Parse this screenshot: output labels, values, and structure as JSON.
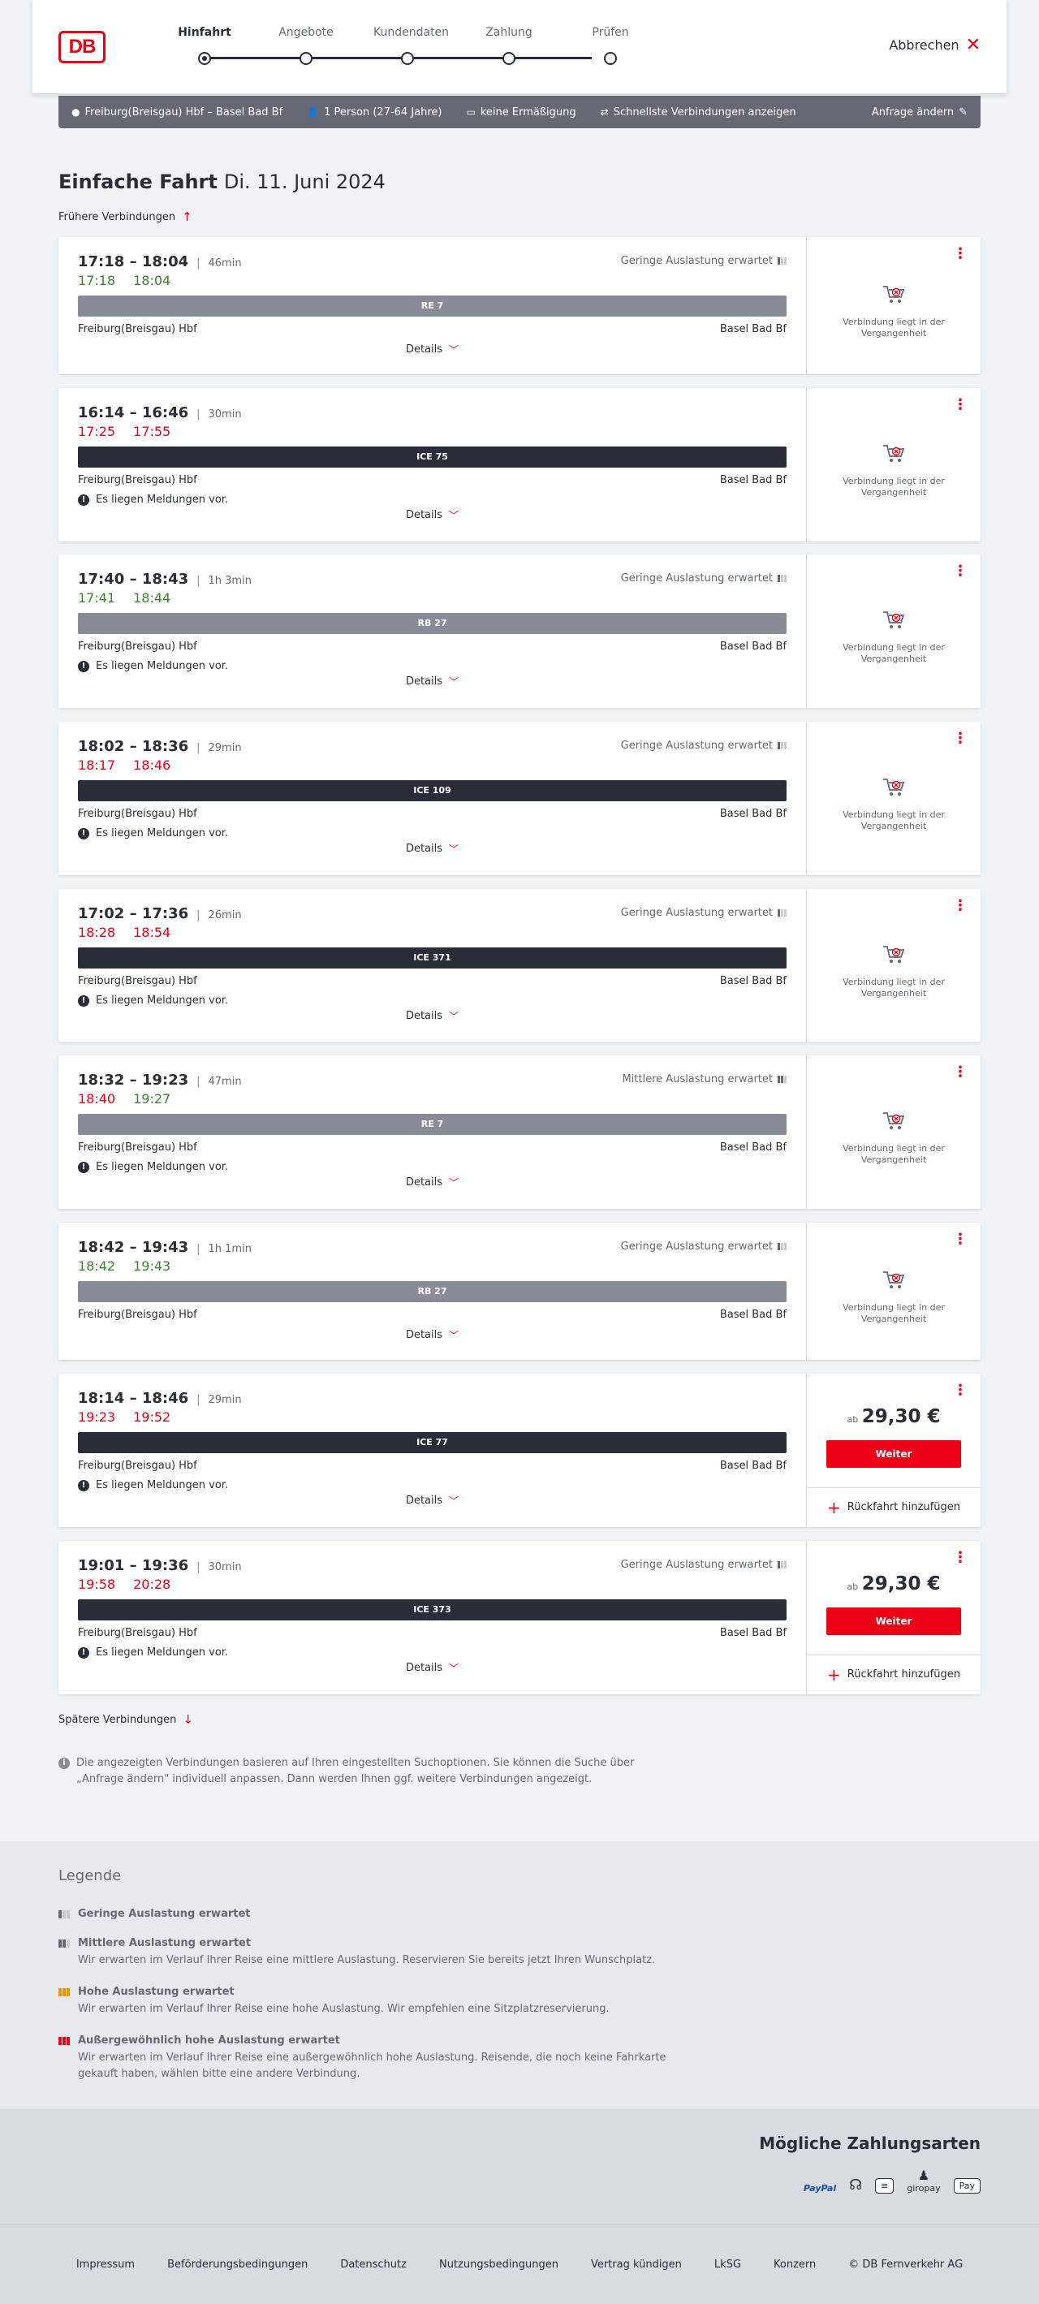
{
  "header": {
    "logo_text": "DB",
    "steps": [
      {
        "label": "Hinfahrt",
        "active": true
      },
      {
        "label": "Angebote",
        "active": false
      },
      {
        "label": "Kundendaten",
        "active": false
      },
      {
        "label": "Zahlung",
        "active": false
      },
      {
        "label": "Prüfen",
        "active": false
      }
    ],
    "cancel_label": "Abbrechen"
  },
  "query": {
    "route": "Freiburg(Breisgau) Hbf – Basel Bad Bf",
    "passengers": "1 Person (27-64 Jahre)",
    "discount": "keine Ermäßigung",
    "fastest": "Schnellste Verbindungen anzeigen",
    "change": "Anfrage ändern"
  },
  "title": {
    "trip_type": "Einfache Fahrt",
    "date": "Di. 11. Juni 2024"
  },
  "earlier_label": "Frühere Verbindungen",
  "later_label": "Spätere Verbindungen",
  "details_label": "Details",
  "notice_text": "Es liegen Meldungen vor.",
  "past_text": "Verbindung liegt in der Vergangenheit",
  "weiter_label": "Weiter",
  "ab_label": "ab",
  "return_label": "Rückfahrt hinzufügen",
  "connections": [
    {
      "planned": "17:18 – 18:04",
      "duration": "46min",
      "rt_dep": "17:18",
      "rt_arr": "18:04",
      "rt_dep_late": false,
      "rt_arr_late": false,
      "train": "RE 7",
      "train_kind": "regional",
      "from": "Freiburg(Breisgau) Hbf",
      "to": "Basel Bad Bf",
      "load": "Geringe Auslastung erwartet",
      "load_level": 1,
      "notice": false,
      "price": null
    },
    {
      "planned": "16:14 – 16:46",
      "duration": "30min",
      "rt_dep": "17:25",
      "rt_arr": "17:55",
      "rt_dep_late": true,
      "rt_arr_late": true,
      "train": "ICE 75",
      "train_kind": "ice",
      "from": "Freiburg(Breisgau) Hbf",
      "to": "Basel Bad Bf",
      "load": "",
      "load_level": 0,
      "notice": true,
      "price": null
    },
    {
      "planned": "17:40 – 18:43",
      "duration": "1h 3min",
      "rt_dep": "17:41",
      "rt_arr": "18:44",
      "rt_dep_late": false,
      "rt_arr_late": false,
      "train": "RB 27",
      "train_kind": "regional",
      "from": "Freiburg(Breisgau) Hbf",
      "to": "Basel Bad Bf",
      "load": "Geringe Auslastung erwartet",
      "load_level": 1,
      "notice": true,
      "price": null
    },
    {
      "planned": "18:02 – 18:36",
      "duration": "29min",
      "rt_dep": "18:17",
      "rt_arr": "18:46",
      "rt_dep_late": true,
      "rt_arr_late": true,
      "train": "ICE 109",
      "train_kind": "ice",
      "from": "Freiburg(Breisgau) Hbf",
      "to": "Basel Bad Bf",
      "load": "Geringe Auslastung erwartet",
      "load_level": 1,
      "notice": true,
      "price": null
    },
    {
      "planned": "17:02 – 17:36",
      "duration": "26min",
      "rt_dep": "18:28",
      "rt_arr": "18:54",
      "rt_dep_late": true,
      "rt_arr_late": true,
      "train": "ICE 371",
      "train_kind": "ice",
      "from": "Freiburg(Breisgau) Hbf",
      "to": "Basel Bad Bf",
      "load": "Geringe Auslastung erwartet",
      "load_level": 1,
      "notice": true,
      "price": null
    },
    {
      "planned": "18:32 – 19:23",
      "duration": "47min",
      "rt_dep": "18:40",
      "rt_arr": "19:27",
      "rt_dep_late": true,
      "rt_arr_late": false,
      "train": "RE 7",
      "train_kind": "regional",
      "from": "Freiburg(Breisgau) Hbf",
      "to": "Basel Bad Bf",
      "load": "Mittlere Auslastung erwartet",
      "load_level": 2,
      "notice": true,
      "price": null
    },
    {
      "planned": "18:42 – 19:43",
      "duration": "1h 1min",
      "rt_dep": "18:42",
      "rt_arr": "19:43",
      "rt_dep_late": false,
      "rt_arr_late": false,
      "train": "RB 27",
      "train_kind": "regional",
      "from": "Freiburg(Breisgau) Hbf",
      "to": "Basel Bad Bf",
      "load": "Geringe Auslastung erwartet",
      "load_level": 1,
      "notice": false,
      "price": null
    },
    {
      "planned": "18:14 – 18:46",
      "duration": "29min",
      "rt_dep": "19:23",
      "rt_arr": "19:52",
      "rt_dep_late": true,
      "rt_arr_late": true,
      "train": "ICE 77",
      "train_kind": "ice",
      "from": "Freiburg(Breisgau) Hbf",
      "to": "Basel Bad Bf",
      "load": "",
      "load_level": 0,
      "notice": true,
      "price": "29,30 €"
    },
    {
      "planned": "19:01 – 19:36",
      "duration": "30min",
      "rt_dep": "19:58",
      "rt_arr": "20:28",
      "rt_dep_late": true,
      "rt_arr_late": true,
      "train": "ICE 373",
      "train_kind": "ice",
      "from": "Freiburg(Breisgau) Hbf",
      "to": "Basel Bad Bf",
      "load": "Geringe Auslastung erwartet",
      "load_level": 1,
      "notice": true,
      "price": "29,30 €"
    }
  ],
  "info_note": "Die angezeigten Verbindungen basieren auf Ihren eingestellten Suchoptionen. Sie können die Suche über „Anfrage ändern\" individuell anpassen. Dann werden Ihnen ggf. weitere Verbindungen angezeigt.",
  "legend": {
    "title": "Legende",
    "items": [
      {
        "head": "Geringe Auslastung erwartet",
        "desc": ""
      },
      {
        "head": "Mittlere Auslastung erwartet",
        "desc": "Wir erwarten im Verlauf Ihrer Reise eine mittlere Auslastung. Reservieren Sie bereits jetzt Ihren Wunschplatz."
      },
      {
        "head": "Hohe Auslastung erwartet",
        "desc": "Wir erwarten im Verlauf Ihrer Reise eine hohe Auslastung. Wir empfehlen eine Sitzplatzreservierung."
      },
      {
        "head": "Außergewöhnlich hohe Auslastung erwartet",
        "desc": "Wir erwarten im Verlauf Ihrer Reise eine außergewöhnlich hohe Auslastung. Reisende, die noch keine Fahrkarte gekauft haben, wählen bitte eine andere Verbindung."
      }
    ]
  },
  "payment": {
    "title": "Mögliche Zahlungsarten",
    "methods": [
      "PayPal",
      "giropay",
      "Pay"
    ]
  },
  "footer": {
    "links": [
      "Impressum",
      "Beförderungsbedingungen",
      "Datenschutz",
      "Nutzungsbedingungen",
      "Vertrag kündigen",
      "LkSG",
      "Konzern",
      "© DB Fernverkehr AG"
    ]
  },
  "colors": {
    "brand_red": "#ec0016",
    "on_time_green": "#408335",
    "dark": "#282d37"
  }
}
